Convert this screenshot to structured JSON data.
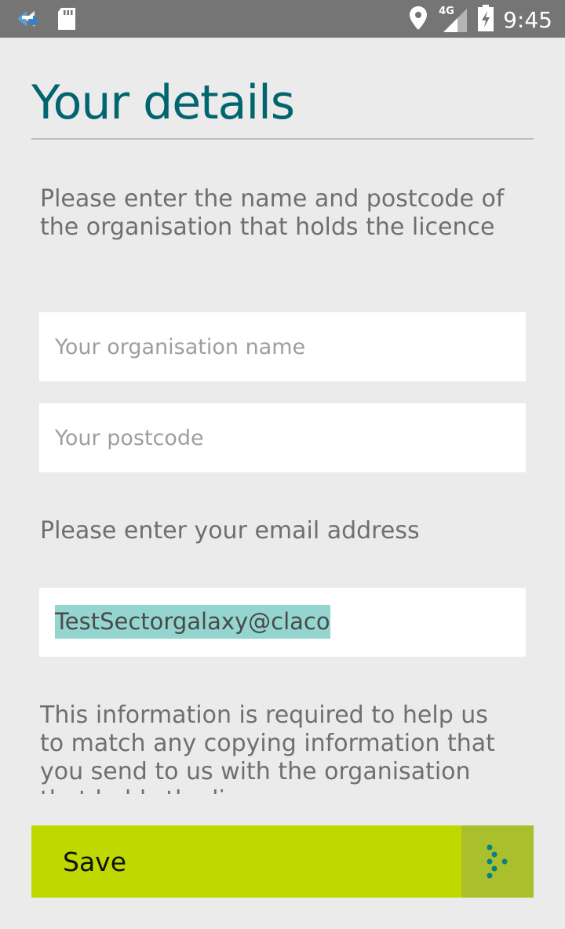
{
  "status_bar": {
    "time": "9:45",
    "network": "4G",
    "icons": [
      "app-notification-icon",
      "sd-card-icon",
      "location-pin-icon",
      "cellular-signal-icon",
      "battery-charging-icon"
    ]
  },
  "page": {
    "title": "Your details",
    "org_instruction": "Please enter the name and postcode of the organisation that holds the licence",
    "email_instruction": "Please enter your email address",
    "info_text": "This information is required to help us to match any copying information that you send to us with the organisation that holds the licence"
  },
  "fields": {
    "organisation": {
      "placeholder": "Your organisation name",
      "value": ""
    },
    "postcode": {
      "placeholder": "Your postcode",
      "value": ""
    },
    "email": {
      "value": "TestSectorgalaxy@claco"
    }
  },
  "actions": {
    "save_label": "Save",
    "save_icon": "dotted-arrow-right-icon"
  },
  "colors": {
    "title": "#00656f",
    "accent": "#bed800",
    "accent_dark": "#aabf2c",
    "selection": "#94d5cf",
    "background": "#ebebeb"
  }
}
